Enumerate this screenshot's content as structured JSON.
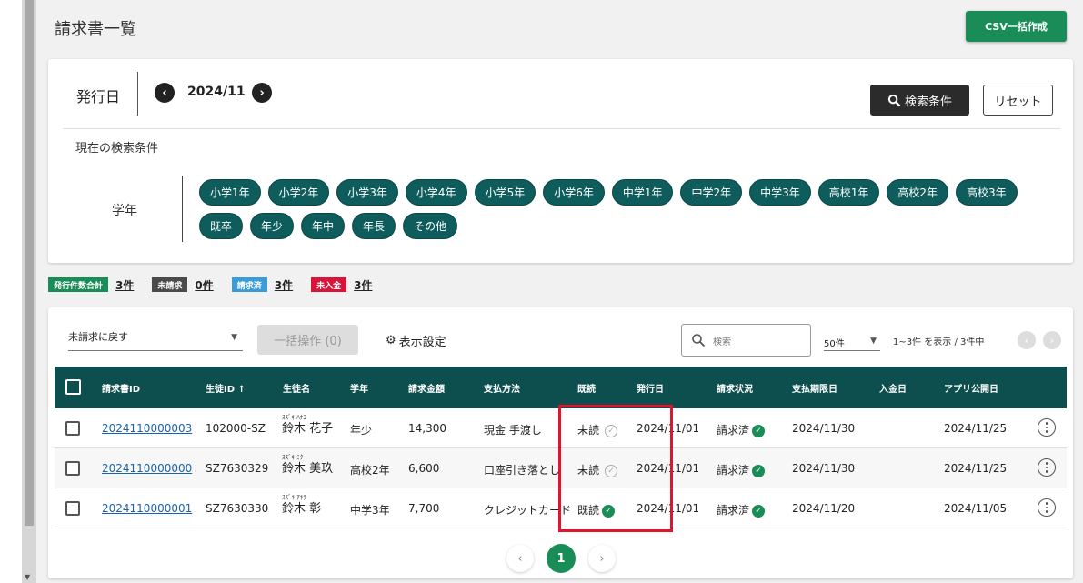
{
  "page": {
    "title": "請求書一覧",
    "csv_button": "CSV一括作成"
  },
  "search": {
    "issue_date_label": "発行日",
    "month": "2024/11",
    "prev_icon": "chevron-left",
    "next_icon": "chevron-right",
    "search_conditions_button": "検索条件",
    "reset_button": "リセット",
    "current_conditions_label": "現在の検索条件",
    "grade_label": "学年",
    "grades": [
      "小学1年",
      "小学2年",
      "小学3年",
      "小学4年",
      "小学5年",
      "小学6年",
      "中学1年",
      "中学2年",
      "中学3年",
      "高校1年",
      "高校2年",
      "高校3年",
      "既卒",
      "年少",
      "年中",
      "年長",
      "その他"
    ]
  },
  "stats": [
    {
      "label": "発行件数合計",
      "value": "3件",
      "color": "#1a8c57"
    },
    {
      "label": "未請求",
      "value": "0件",
      "color": "#4a4a4a"
    },
    {
      "label": "請求済",
      "value": "3件",
      "color": "#3a9bd9"
    },
    {
      "label": "未入金",
      "value": "3件",
      "color": "#d9143a"
    }
  ],
  "toolbar": {
    "bulk_select_value": "未請求に戻す",
    "bulk_action_button": "一括操作 (0)",
    "display_settings": "表示設定",
    "search_placeholder": "検索",
    "per_page": "50件",
    "range_text": "1~3件 を表示 / 3件中"
  },
  "table": {
    "headers": {
      "invoice_id": "請求書ID",
      "student_id": "生徒ID",
      "student_name": "生徒名",
      "grade": "学年",
      "amount": "請求金額",
      "payment": "支払方法",
      "read": "既読",
      "issue_date": "発行日",
      "invoice_status": "請求状況",
      "due_date": "支払期限日",
      "paid_date": "入金日",
      "app_publish_date": "アプリ公開日"
    },
    "sort_indicator": "↑",
    "rows": [
      {
        "invoice_id": "2024110000003",
        "student_id": "102000-SZ",
        "kana": "ｽｽﾞｷ ﾊﾅｺ",
        "name": "鈴木 花子",
        "grade": "年少",
        "amount": "14,300",
        "payment": "現金 手渡し",
        "read": "未読",
        "read_state": "unread",
        "issue_date": "2024/11/01",
        "status": "請求済",
        "due_date": "2024/11/30",
        "paid_date": "",
        "app_date": "2024/11/25"
      },
      {
        "invoice_id": "2024110000000",
        "student_id": "SZ7630329",
        "kana": "ｽｽﾞｷ ﾐｸ",
        "name": "鈴木 美玖",
        "grade": "高校2年",
        "amount": "6,600",
        "payment": "口座引き落とし",
        "read": "未読",
        "read_state": "unread",
        "issue_date": "2024/11/01",
        "status": "請求済",
        "due_date": "2024/11/30",
        "paid_date": "",
        "app_date": "2024/11/25"
      },
      {
        "invoice_id": "2024110000001",
        "student_id": "SZ7630330",
        "kana": "ｽｽﾞｷ ｱｷﾗ",
        "name": "鈴木 彰",
        "grade": "中学3年",
        "amount": "7,700",
        "payment": "クレジットカード",
        "read": "既読",
        "read_state": "read",
        "issue_date": "2024/11/01",
        "status": "請求済",
        "due_date": "2024/11/20",
        "paid_date": "",
        "app_date": "2024/11/05"
      }
    ]
  },
  "pager": {
    "current": "1"
  },
  "colors": {
    "primary": "#1a8c57",
    "header_bg": "#0d4f4f",
    "chip_bg": "#0e5c5c",
    "highlight": "#e0142a",
    "link": "#1a62b0"
  }
}
